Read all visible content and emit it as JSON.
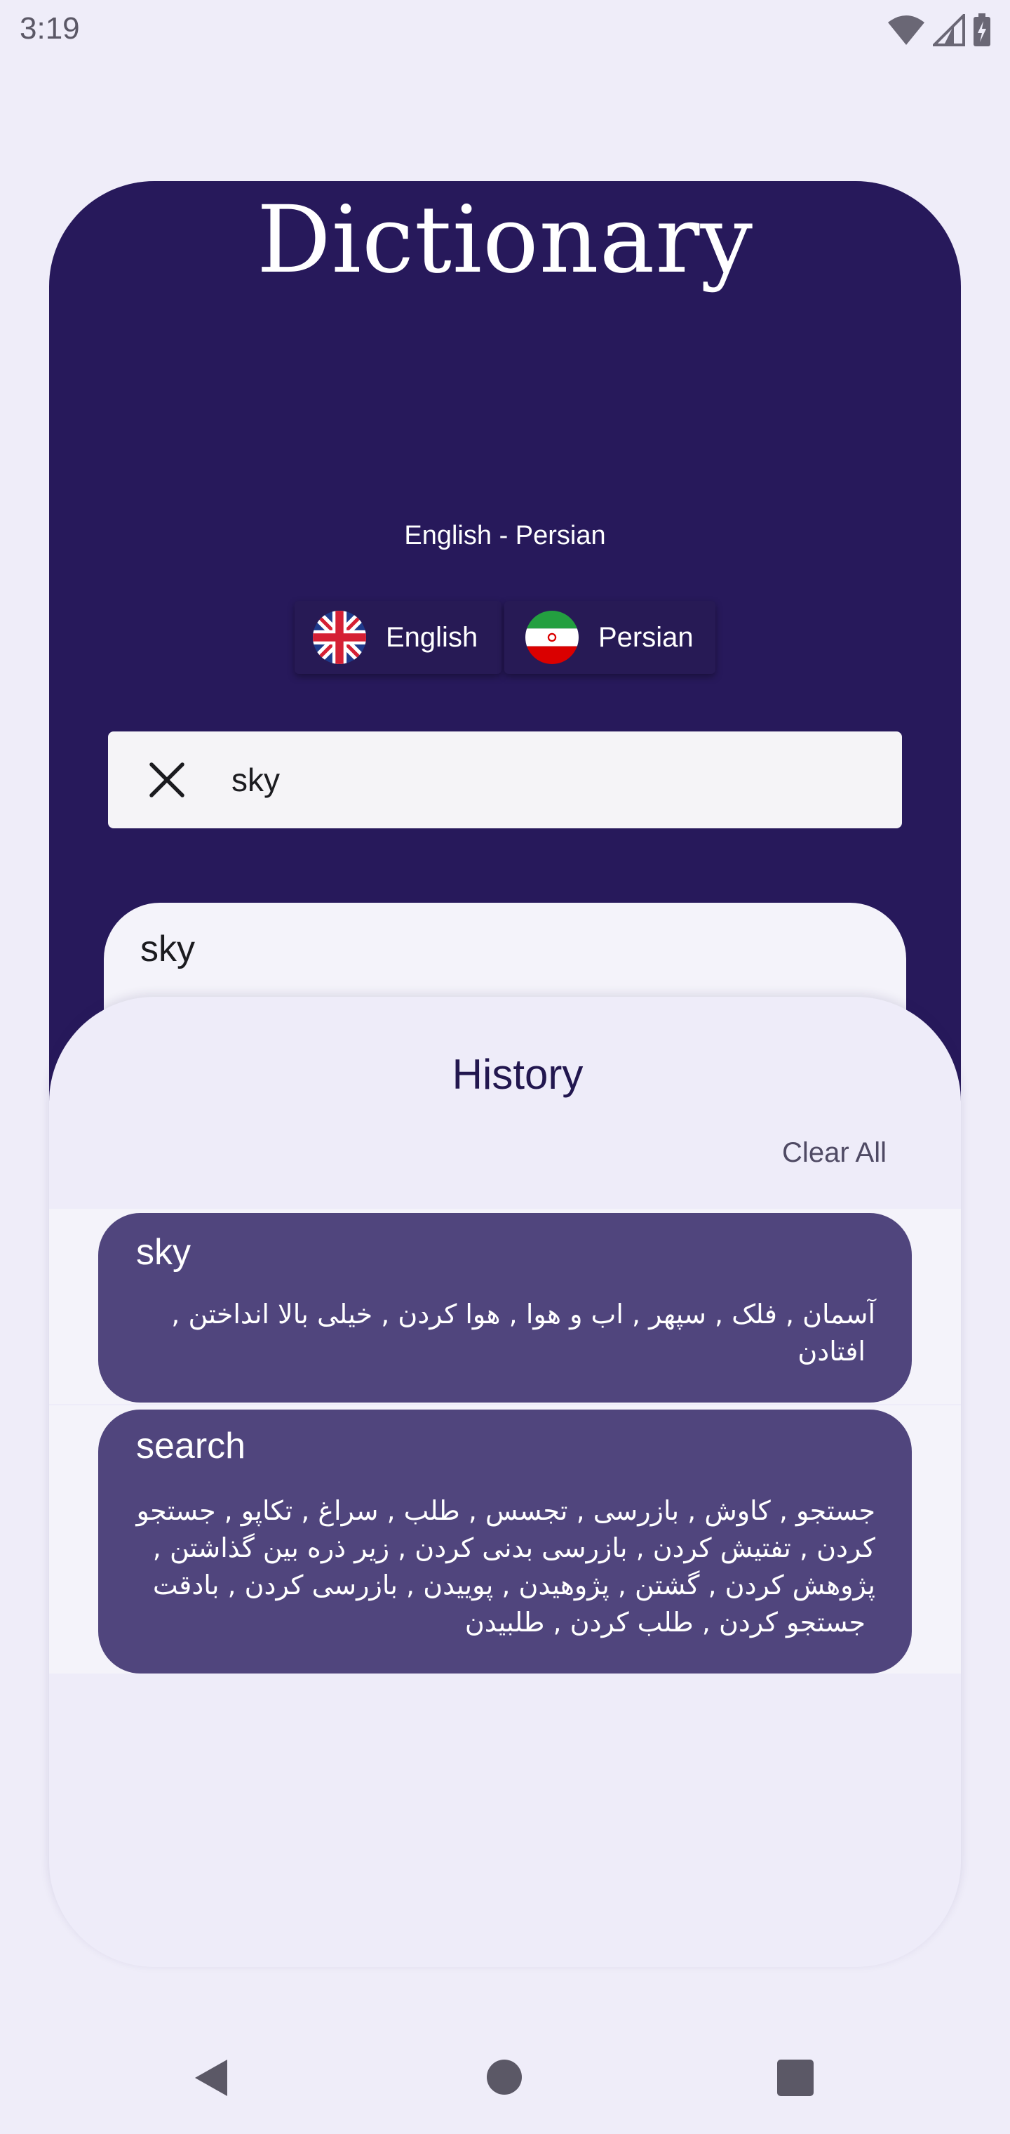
{
  "status_bar": {
    "time": "3:19",
    "icons": [
      "wifi-icon",
      "cellular-signal-icon",
      "battery-charging-icon"
    ]
  },
  "header": {
    "title": "Dictionary",
    "subtitle": "English - Persian",
    "languages": [
      {
        "label": "English",
        "flag": "uk-flag-icon"
      },
      {
        "label": "Persian",
        "flag": "iran-flag-icon"
      }
    ]
  },
  "search": {
    "value": "sky",
    "clear_icon": "close-icon"
  },
  "result": {
    "word": "sky"
  },
  "history": {
    "title": "History",
    "clear_all": "Clear All",
    "items": [
      {
        "word": "sky",
        "definition_lines": [
          "آسمان , فلک , سپهر , اب و هوا , هوا کردن , خیلی بالا انداختن ,",
          "افتادن"
        ]
      },
      {
        "word": "search",
        "definition_lines": [
          "جستجو , کاوش , بازرسی , تجسس , طلب , سراغ , تکاپو , جستجو",
          "کردن , تفتیش کردن , بازرسی بدنی کردن , زیر ذره بین گذاشتن ,",
          "پژوهش کردن , گشتن , پژوهیدن , پوییدن , بازرسی کردن , بادقت",
          "جستجو کردن , طلب کردن , طلبیدن"
        ]
      }
    ]
  },
  "nav_bar": {
    "buttons": [
      "back-icon",
      "home-icon",
      "recents-icon"
    ]
  },
  "colors": {
    "header_bg": "#27195b",
    "history_card": "#50457d",
    "page_bg": "#efedf9"
  }
}
